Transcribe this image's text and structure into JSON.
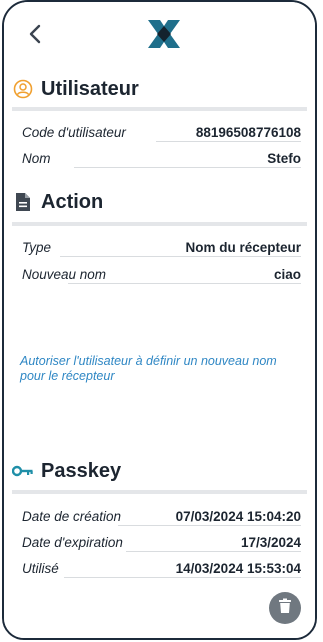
{
  "header": {
    "back_icon": "chevron-left-icon",
    "logo": "app-logo"
  },
  "user_section": {
    "title": "Utilisateur",
    "icon": "user-circle-icon",
    "rows": [
      {
        "label": "Code d'utilisateur",
        "value": "88196508776108"
      },
      {
        "label": "Nom",
        "value": "Stefo"
      }
    ]
  },
  "action_section": {
    "title": "Action",
    "icon": "document-icon",
    "rows": [
      {
        "label": "Type",
        "value": "Nom du récepteur"
      },
      {
        "label": "Nouveau nom",
        "value": "ciao"
      }
    ],
    "description": "Autoriser l'utilisateur à définir un nouveau nom pour le récepteur"
  },
  "passkey_section": {
    "title": "Passkey",
    "icon": "key-icon",
    "rows": [
      {
        "label": "Date de création",
        "value": "07/03/2024 15:04:20"
      },
      {
        "label": "Date d'expiration",
        "value": "17/3/2024"
      },
      {
        "label": "Utilisé",
        "value": "14/03/2024 15:53:04"
      }
    ]
  },
  "fab": {
    "icon": "trash-icon"
  },
  "colors": {
    "accent_orange": "#f0a030",
    "dark": "#1c2530",
    "link": "#2f87c4",
    "key_teal": "#1f6f8b"
  }
}
